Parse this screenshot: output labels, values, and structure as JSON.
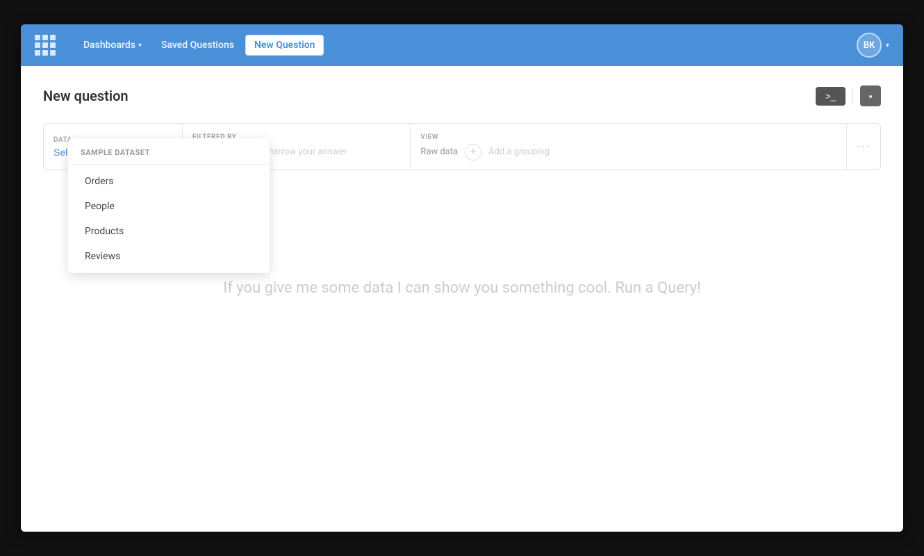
{
  "nav": {
    "dashboards_label": "Dashboards",
    "saved_questions_label": "Saved Questions",
    "new_question_label": "New Question",
    "user_initials": "BK"
  },
  "page": {
    "title": "New question",
    "terminal_label": ">_",
    "notebook_icon": "▦"
  },
  "query_bar": {
    "data_section_label": "DATA",
    "filter_section_label": "FILTERED BY",
    "view_section_label": "VIEW",
    "select_table_label": "Select a table",
    "add_filter_label": "+",
    "filter_placeholder": "Add filters to narrow your answer",
    "raw_data_label": "Raw data",
    "add_grouping_label": "+",
    "grouping_placeholder": "Add a grouping",
    "options_label": "···"
  },
  "dropdown": {
    "header": "Sample Dataset",
    "items": [
      {
        "label": "Orders"
      },
      {
        "label": "People"
      },
      {
        "label": "Products"
      },
      {
        "label": "Reviews"
      }
    ]
  },
  "empty_state": {
    "message": "If you give me some data I can show you something cool. Run a Query!"
  }
}
